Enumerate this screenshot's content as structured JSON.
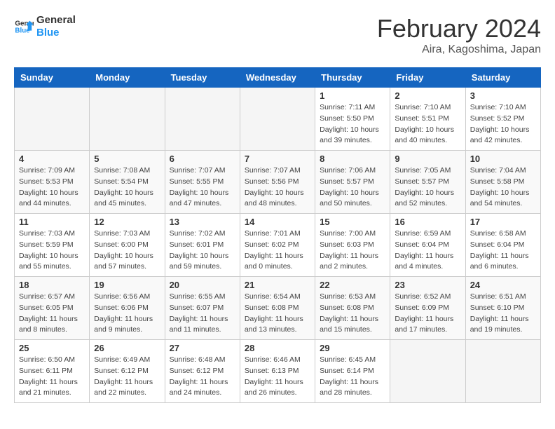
{
  "header": {
    "logo_line1": "General",
    "logo_line2": "Blue",
    "month_year": "February 2024",
    "location": "Aira, Kagoshima, Japan"
  },
  "weekdays": [
    "Sunday",
    "Monday",
    "Tuesday",
    "Wednesday",
    "Thursday",
    "Friday",
    "Saturday"
  ],
  "weeks": [
    [
      {
        "day": "",
        "info": ""
      },
      {
        "day": "",
        "info": ""
      },
      {
        "day": "",
        "info": ""
      },
      {
        "day": "",
        "info": ""
      },
      {
        "day": "1",
        "info": "Sunrise: 7:11 AM\nSunset: 5:50 PM\nDaylight: 10 hours\nand 39 minutes."
      },
      {
        "day": "2",
        "info": "Sunrise: 7:10 AM\nSunset: 5:51 PM\nDaylight: 10 hours\nand 40 minutes."
      },
      {
        "day": "3",
        "info": "Sunrise: 7:10 AM\nSunset: 5:52 PM\nDaylight: 10 hours\nand 42 minutes."
      }
    ],
    [
      {
        "day": "4",
        "info": "Sunrise: 7:09 AM\nSunset: 5:53 PM\nDaylight: 10 hours\nand 44 minutes."
      },
      {
        "day": "5",
        "info": "Sunrise: 7:08 AM\nSunset: 5:54 PM\nDaylight: 10 hours\nand 45 minutes."
      },
      {
        "day": "6",
        "info": "Sunrise: 7:07 AM\nSunset: 5:55 PM\nDaylight: 10 hours\nand 47 minutes."
      },
      {
        "day": "7",
        "info": "Sunrise: 7:07 AM\nSunset: 5:56 PM\nDaylight: 10 hours\nand 48 minutes."
      },
      {
        "day": "8",
        "info": "Sunrise: 7:06 AM\nSunset: 5:57 PM\nDaylight: 10 hours\nand 50 minutes."
      },
      {
        "day": "9",
        "info": "Sunrise: 7:05 AM\nSunset: 5:57 PM\nDaylight: 10 hours\nand 52 minutes."
      },
      {
        "day": "10",
        "info": "Sunrise: 7:04 AM\nSunset: 5:58 PM\nDaylight: 10 hours\nand 54 minutes."
      }
    ],
    [
      {
        "day": "11",
        "info": "Sunrise: 7:03 AM\nSunset: 5:59 PM\nDaylight: 10 hours\nand 55 minutes."
      },
      {
        "day": "12",
        "info": "Sunrise: 7:03 AM\nSunset: 6:00 PM\nDaylight: 10 hours\nand 57 minutes."
      },
      {
        "day": "13",
        "info": "Sunrise: 7:02 AM\nSunset: 6:01 PM\nDaylight: 10 hours\nand 59 minutes."
      },
      {
        "day": "14",
        "info": "Sunrise: 7:01 AM\nSunset: 6:02 PM\nDaylight: 11 hours\nand 0 minutes."
      },
      {
        "day": "15",
        "info": "Sunrise: 7:00 AM\nSunset: 6:03 PM\nDaylight: 11 hours\nand 2 minutes."
      },
      {
        "day": "16",
        "info": "Sunrise: 6:59 AM\nSunset: 6:04 PM\nDaylight: 11 hours\nand 4 minutes."
      },
      {
        "day": "17",
        "info": "Sunrise: 6:58 AM\nSunset: 6:04 PM\nDaylight: 11 hours\nand 6 minutes."
      }
    ],
    [
      {
        "day": "18",
        "info": "Sunrise: 6:57 AM\nSunset: 6:05 PM\nDaylight: 11 hours\nand 8 minutes."
      },
      {
        "day": "19",
        "info": "Sunrise: 6:56 AM\nSunset: 6:06 PM\nDaylight: 11 hours\nand 9 minutes."
      },
      {
        "day": "20",
        "info": "Sunrise: 6:55 AM\nSunset: 6:07 PM\nDaylight: 11 hours\nand 11 minutes."
      },
      {
        "day": "21",
        "info": "Sunrise: 6:54 AM\nSunset: 6:08 PM\nDaylight: 11 hours\nand 13 minutes."
      },
      {
        "day": "22",
        "info": "Sunrise: 6:53 AM\nSunset: 6:08 PM\nDaylight: 11 hours\nand 15 minutes."
      },
      {
        "day": "23",
        "info": "Sunrise: 6:52 AM\nSunset: 6:09 PM\nDaylight: 11 hours\nand 17 minutes."
      },
      {
        "day": "24",
        "info": "Sunrise: 6:51 AM\nSunset: 6:10 PM\nDaylight: 11 hours\nand 19 minutes."
      }
    ],
    [
      {
        "day": "25",
        "info": "Sunrise: 6:50 AM\nSunset: 6:11 PM\nDaylight: 11 hours\nand 21 minutes."
      },
      {
        "day": "26",
        "info": "Sunrise: 6:49 AM\nSunset: 6:12 PM\nDaylight: 11 hours\nand 22 minutes."
      },
      {
        "day": "27",
        "info": "Sunrise: 6:48 AM\nSunset: 6:12 PM\nDaylight: 11 hours\nand 24 minutes."
      },
      {
        "day": "28",
        "info": "Sunrise: 6:46 AM\nSunset: 6:13 PM\nDaylight: 11 hours\nand 26 minutes."
      },
      {
        "day": "29",
        "info": "Sunrise: 6:45 AM\nSunset: 6:14 PM\nDaylight: 11 hours\nand 28 minutes."
      },
      {
        "day": "",
        "info": ""
      },
      {
        "day": "",
        "info": ""
      }
    ]
  ]
}
